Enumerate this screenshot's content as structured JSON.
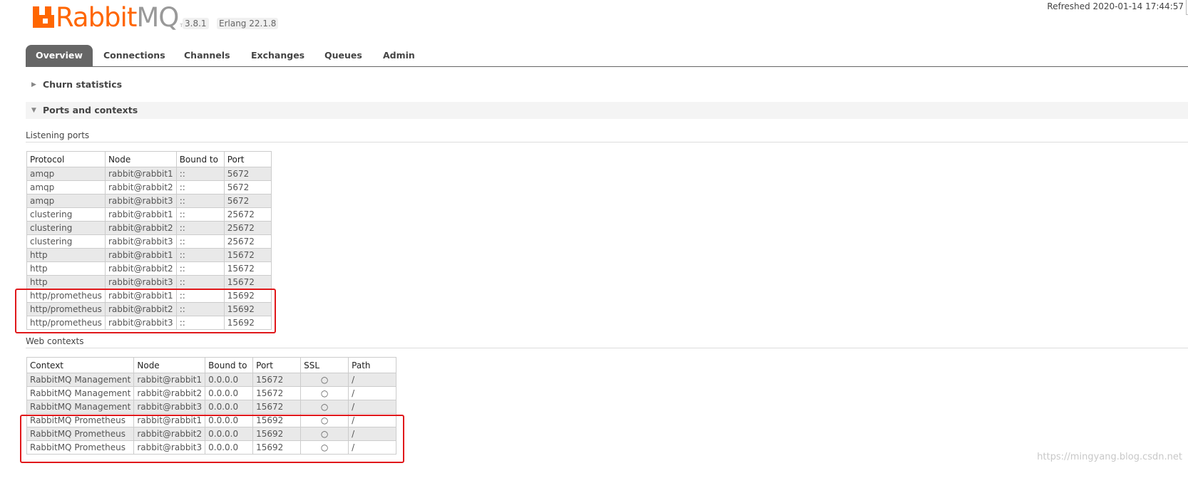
{
  "header": {
    "logo_rabbit": "Rabbit",
    "logo_mq": "MQ",
    "logo_tm": "TM",
    "version": "3.8.1",
    "erlang": "Erlang 22.1.8",
    "refreshed": "Refreshed 2020-01-14 17:44:57"
  },
  "tabs": [
    "Overview",
    "Connections",
    "Channels",
    "Exchanges",
    "Queues",
    "Admin"
  ],
  "sections": {
    "churn": "Churn statistics",
    "ports": "Ports and contexts"
  },
  "listening_ports": {
    "heading": "Listening ports",
    "columns": [
      "Protocol",
      "Node",
      "Bound to",
      "Port"
    ],
    "rows": [
      [
        "amqp",
        "rabbit@rabbit1",
        "::",
        "5672"
      ],
      [
        "amqp",
        "rabbit@rabbit2",
        "::",
        "5672"
      ],
      [
        "amqp",
        "rabbit@rabbit3",
        "::",
        "5672"
      ],
      [
        "clustering",
        "rabbit@rabbit1",
        "::",
        "25672"
      ],
      [
        "clustering",
        "rabbit@rabbit2",
        "::",
        "25672"
      ],
      [
        "clustering",
        "rabbit@rabbit3",
        "::",
        "25672"
      ],
      [
        "http",
        "rabbit@rabbit1",
        "::",
        "15672"
      ],
      [
        "http",
        "rabbit@rabbit2",
        "::",
        "15672"
      ],
      [
        "http",
        "rabbit@rabbit3",
        "::",
        "15672"
      ],
      [
        "http/prometheus",
        "rabbit@rabbit1",
        "::",
        "15692"
      ],
      [
        "http/prometheus",
        "rabbit@rabbit2",
        "::",
        "15692"
      ],
      [
        "http/prometheus",
        "rabbit@rabbit3",
        "::",
        "15692"
      ]
    ]
  },
  "web_contexts": {
    "heading": "Web contexts",
    "columns": [
      "Context",
      "Node",
      "Bound to",
      "Port",
      "SSL",
      "Path"
    ],
    "rows": [
      [
        "RabbitMQ Management",
        "rabbit@rabbit1",
        "0.0.0.0",
        "15672",
        "○",
        "/"
      ],
      [
        "RabbitMQ Management",
        "rabbit@rabbit2",
        "0.0.0.0",
        "15672",
        "○",
        "/"
      ],
      [
        "RabbitMQ Management",
        "rabbit@rabbit3",
        "0.0.0.0",
        "15672",
        "○",
        "/"
      ],
      [
        "RabbitMQ Prometheus",
        "rabbit@rabbit1",
        "0.0.0.0",
        "15692",
        "○",
        "/"
      ],
      [
        "RabbitMQ Prometheus",
        "rabbit@rabbit2",
        "0.0.0.0",
        "15692",
        "○",
        "/"
      ],
      [
        "RabbitMQ Prometheus",
        "rabbit@rabbit3",
        "0.0.0.0",
        "15692",
        "○",
        "/"
      ]
    ]
  },
  "watermark": "https://mingyang.blog.csdn.net",
  "colors": {
    "brand": "#ff6600",
    "tab_active": "#666666",
    "highlight": "#e0181b"
  }
}
